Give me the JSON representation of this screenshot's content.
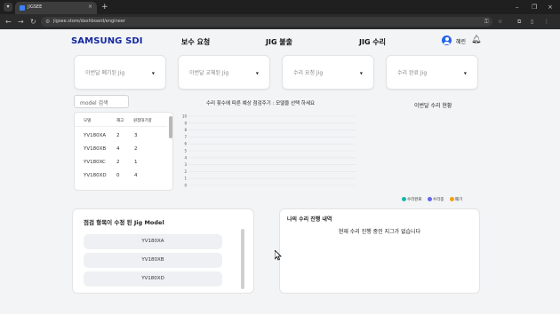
{
  "browser": {
    "tab_title": "JIGSEE",
    "url": "jigsee.store/dashboard/engineer"
  },
  "header": {
    "logo": "SAMSUNG SDI",
    "nav": [
      "보수 요청",
      "JIG 불출",
      "JIG 수리"
    ],
    "user_name": "혜린"
  },
  "selectors": [
    {
      "label": "이번달 폐기된 Jig"
    },
    {
      "label": "이번달 교체된 Jig"
    },
    {
      "label": "수리 요청 Jig"
    },
    {
      "label": "수리 완료 Jig"
    }
  ],
  "search": {
    "placeholder": "model 검색"
  },
  "table": {
    "columns": [
      "모델",
      "재고",
      "원정대기량"
    ],
    "rows": [
      [
        "YV180XA",
        "2",
        "3"
      ],
      [
        "YV180XB",
        "4",
        "2"
      ],
      [
        "YV180XC",
        "2",
        "1"
      ],
      [
        "YV180XD",
        "0",
        "4"
      ]
    ]
  },
  "chart_title": "수리 횟수에 따른 예상 점검주기 : 모델을 선택 하세요",
  "monthly_title": "이번달 수리 현황",
  "legend": [
    {
      "label": "수리완료",
      "color": "#14b8a6"
    },
    {
      "label": "수리중",
      "color": "#6366f1"
    },
    {
      "label": "폐기",
      "color": "#f59e0b"
    }
  ],
  "chart_data": {
    "type": "line",
    "title": "수리 횟수에 따른 예상 점검주기 : 모델을 선택 하세요",
    "y_ticks": [
      "10",
      "9",
      "8",
      "7",
      "6",
      "5",
      "4",
      "3",
      "2",
      "1",
      "0"
    ],
    "ylim": [
      0,
      10
    ],
    "grid": true,
    "series": []
  },
  "modified_models": {
    "title": "점검 항목이 수정 된 Jig Model",
    "items": [
      "YV180XA",
      "YV180XB",
      "YV180XD"
    ]
  },
  "repair_history": {
    "title": "나의 수리 진행 내역",
    "empty_message": "현재 수리 진행 중인 지그가 없습니다"
  }
}
